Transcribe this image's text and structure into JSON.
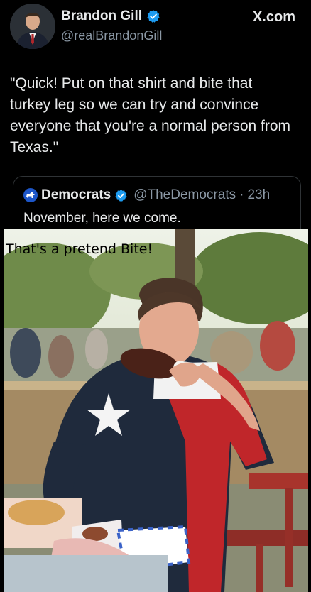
{
  "author": {
    "display_name": "Brandon Gill",
    "handle": "@realBrandonGill",
    "verified_icon": "verified-badge-icon"
  },
  "source": {
    "label": "X.com"
  },
  "tweet": {
    "text": "\"Quick! Put on that shirt and bite that turkey leg so we can try and convince everyone that you're a normal person from Texas.\""
  },
  "quote": {
    "display_name": "Democrats",
    "handle": "@TheDemocrats",
    "separator": "·",
    "time": "23h",
    "text": "November, here we come.",
    "avatar_icon": "donkey-logo-icon"
  },
  "photo": {
    "overlay_text": "That's a pretend Bite!",
    "shirt_colors": {
      "blue": "#1f2a3c",
      "white": "#f2f2f2",
      "red": "#c0262a"
    }
  },
  "colors": {
    "background": "#000000",
    "primary_text": "#e7e9ea",
    "secondary_text": "#8b98a5",
    "verified_blue": "#1d9bf0",
    "card_border": "#2f3336"
  }
}
